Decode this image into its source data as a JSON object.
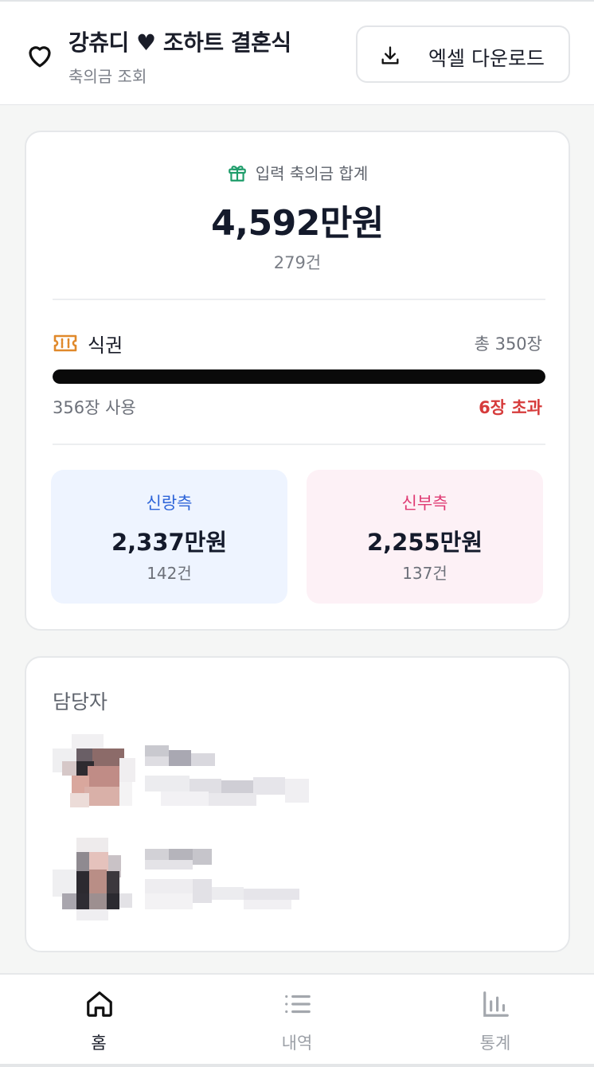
{
  "header": {
    "title": "강츄디 ♥ 조하트 결혼식",
    "subtitle": "축의금 조회",
    "excel_button_label": "엑셀 다운로드"
  },
  "summary": {
    "total_label": "입력 축의금 합계",
    "total_value": "4,592만원",
    "total_count": "279건"
  },
  "tickets": {
    "label": "식권",
    "total": "총 350장",
    "used": "356장 사용",
    "over": "6장 초과",
    "used_fraction": 1.0
  },
  "sides": {
    "groom": {
      "label": "신랑측",
      "value": "2,337만원",
      "count": "142건"
    },
    "bride": {
      "label": "신부측",
      "value": "2,255만원",
      "count": "137건"
    }
  },
  "managers": {
    "title": "담당자"
  },
  "nav": {
    "items": [
      {
        "label": "홈",
        "icon": "home-icon",
        "active": true
      },
      {
        "label": "내역",
        "icon": "list-icon",
        "active": false
      },
      {
        "label": "통계",
        "icon": "bar-chart-icon",
        "active": false
      }
    ]
  },
  "colors": {
    "groom_accent": "#2d64d8",
    "bride_accent": "#df3a73",
    "over_red": "#d63b3b",
    "gift_green": "#1f9d6b",
    "ticket_orange": "#e0892b"
  }
}
